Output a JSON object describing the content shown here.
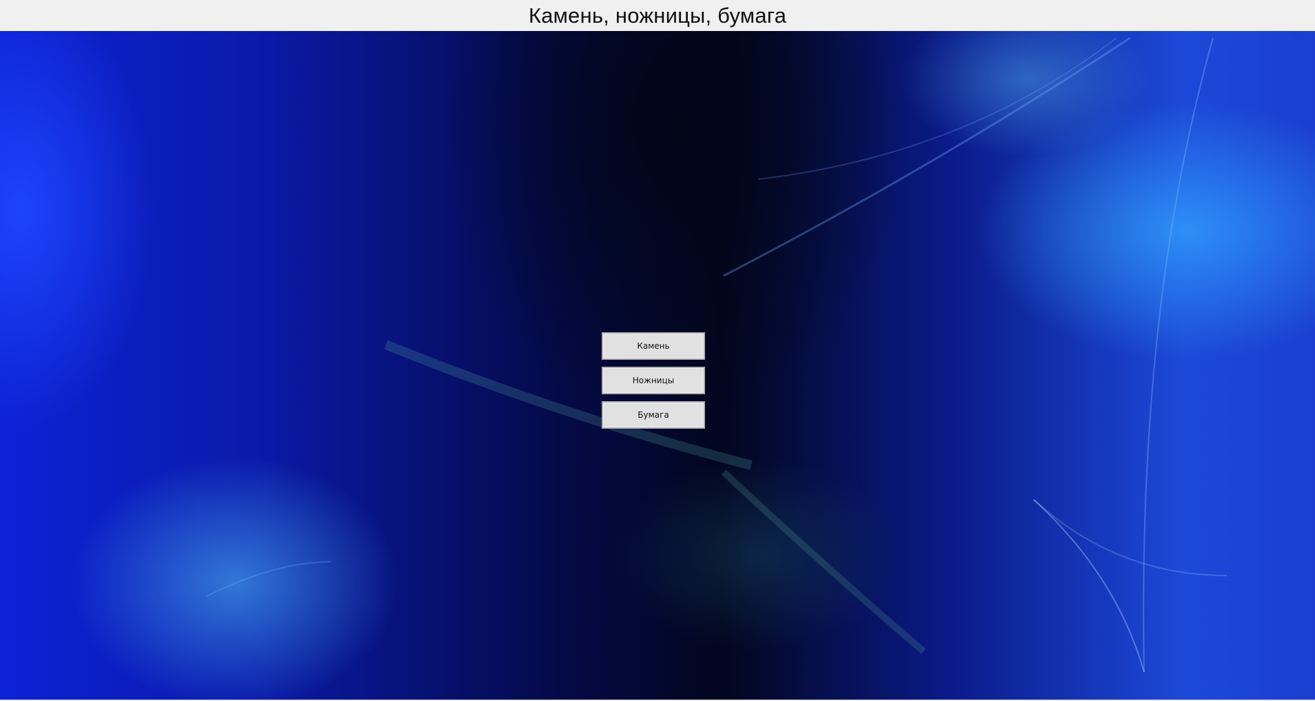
{
  "window": {
    "title": "Камень, ножницы, бумага"
  },
  "game": {
    "choices": [
      {
        "label": "Камень"
      },
      {
        "label": "Ножницы"
      },
      {
        "label": "Бумага"
      }
    ]
  },
  "theme": {
    "title_bar_color": "#f0f0f0",
    "button_color": "#e1e1e1",
    "button_border_color": "#adadad",
    "background_style": "blue abstract wallpaper"
  }
}
